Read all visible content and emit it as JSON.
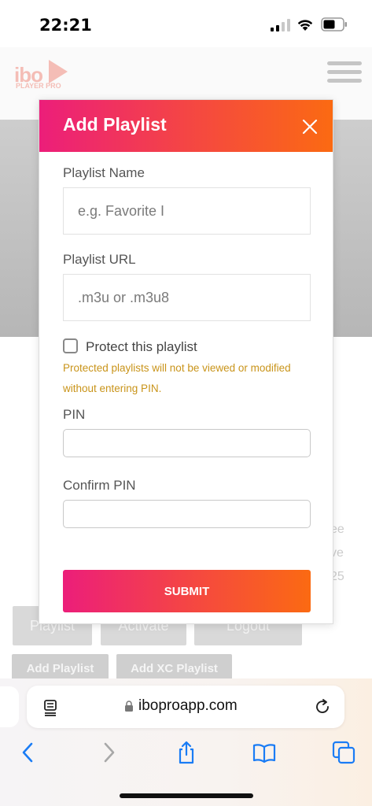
{
  "status_bar": {
    "time": "22:21"
  },
  "background": {
    "logo_text": "ibo",
    "logo_sub": "PLAYER PRO",
    "side_text": [
      "ee",
      "ve",
      "25"
    ],
    "buttons_row1": [
      "Playlist",
      "Activate",
      "Logout"
    ],
    "buttons_row2": [
      "Add Playlist",
      "Add XC Playlist"
    ]
  },
  "modal": {
    "title": "Add Playlist",
    "playlist_name_label": "Playlist Name",
    "playlist_name_placeholder": "e.g. Favorite I",
    "playlist_url_label": "Playlist URL",
    "playlist_url_placeholder": ".m3u or .m3u8",
    "protect_label": "Protect this playlist",
    "protect_help": "Protected playlists will not be viewed or modified without entering PIN.",
    "pin_label": "PIN",
    "confirm_pin_label": "Confirm PIN",
    "submit_label": "SUBMIT"
  },
  "browser": {
    "url": "iboproapp.com"
  },
  "colors": {
    "gradient_start": "#ec1e7a",
    "gradient_end": "#fb6a12",
    "help_text": "#c9941a",
    "ios_blue": "#1a7cf5"
  }
}
